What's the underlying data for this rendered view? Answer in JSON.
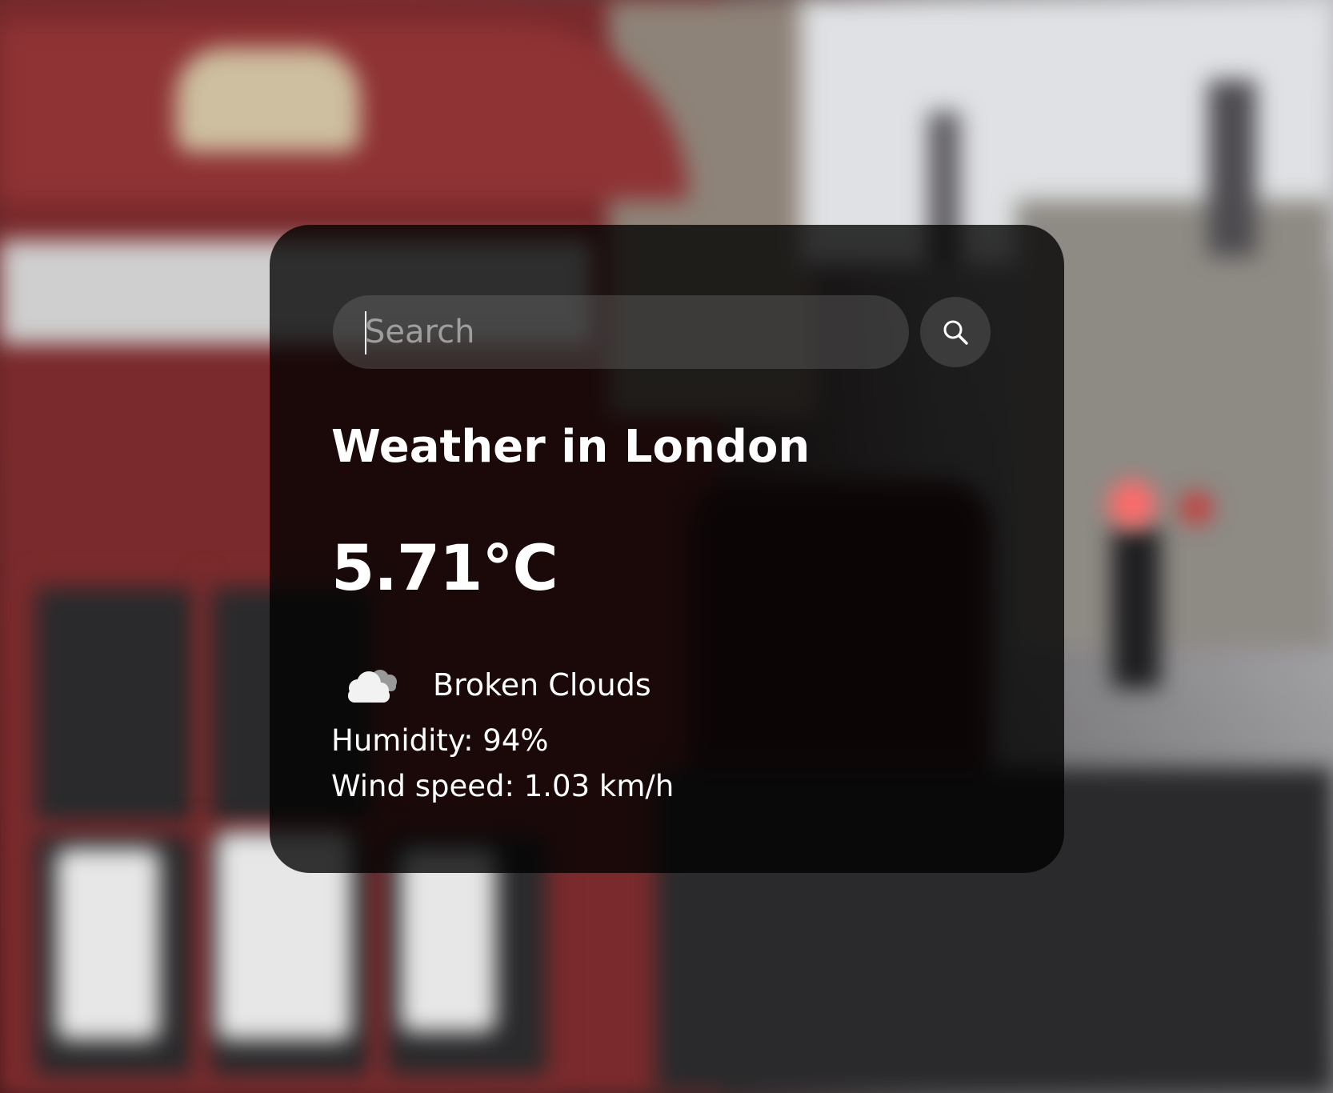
{
  "background": {
    "description_icon": "london-street-photo",
    "accent": "#7c2f31"
  },
  "search": {
    "placeholder": "Search",
    "value": "",
    "button_icon": "search-icon"
  },
  "weather": {
    "title": "Weather in London",
    "temperature": "5.71°C",
    "condition_icon": "broken-clouds-icon",
    "description": "Broken Clouds",
    "humidity": "Humidity: 94%",
    "wind": "Wind speed: 1.03 km/h"
  },
  "colors": {
    "card_bg": "#000000",
    "text": "#ffffff",
    "input_bg": "#7d7d7d"
  }
}
